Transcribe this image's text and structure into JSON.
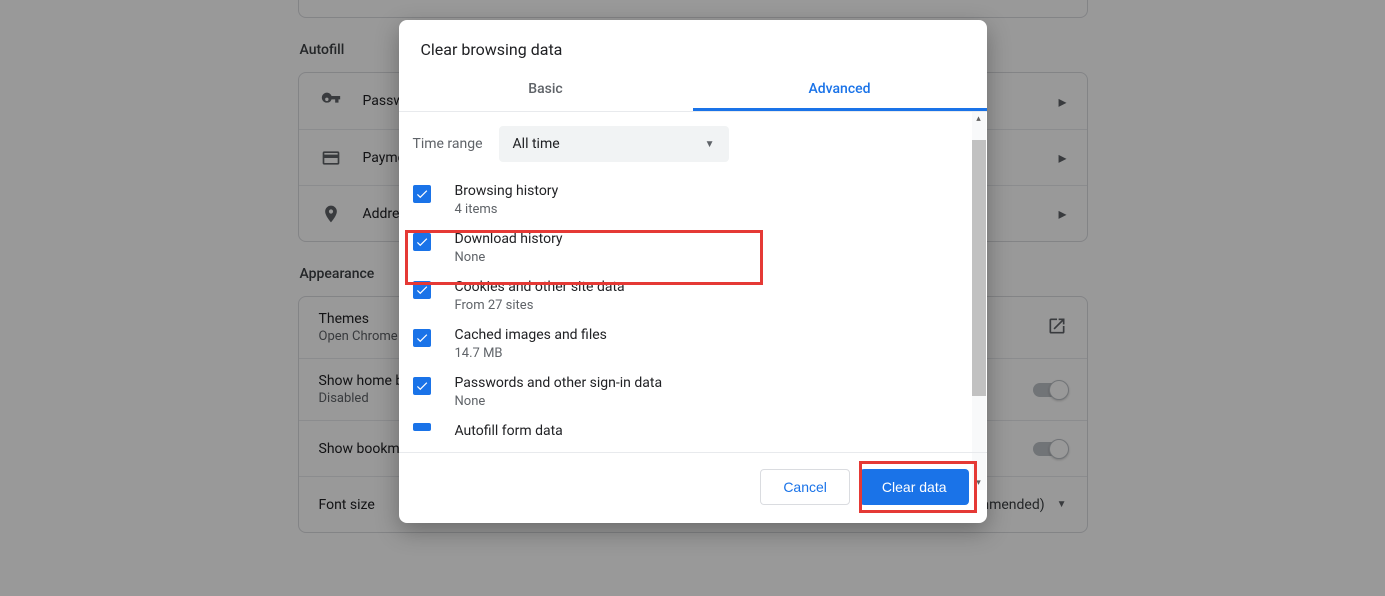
{
  "settings": {
    "autofill_title": "Autofill",
    "autofill_items": [
      {
        "label": "Passwords"
      },
      {
        "label": "Payment methods"
      },
      {
        "label": "Addresses and more"
      }
    ],
    "appearance_title": "Appearance",
    "themes": {
      "label": "Themes",
      "sub": "Open Chrome Web Store"
    },
    "home": {
      "label": "Show home button",
      "sub": "Disabled"
    },
    "bookmarks": {
      "label": "Show bookmarks bar"
    },
    "font": {
      "label": "Font size",
      "value": "Medium (Recommended)"
    }
  },
  "dialog": {
    "title": "Clear browsing data",
    "tabs": {
      "basic": "Basic",
      "advanced": "Advanced"
    },
    "time_range": {
      "label": "Time range",
      "value": "All time"
    },
    "items": [
      {
        "primary": "Browsing history",
        "secondary": "4 items"
      },
      {
        "primary": "Download history",
        "secondary": "None"
      },
      {
        "primary": "Cookies and other site data",
        "secondary": "From 27 sites"
      },
      {
        "primary": "Cached images and files",
        "secondary": "14.7 MB"
      },
      {
        "primary": "Passwords and other sign-in data",
        "secondary": "None"
      },
      {
        "primary": "Autofill form data",
        "secondary": ""
      }
    ],
    "cancel": "Cancel",
    "clear": "Clear data"
  }
}
